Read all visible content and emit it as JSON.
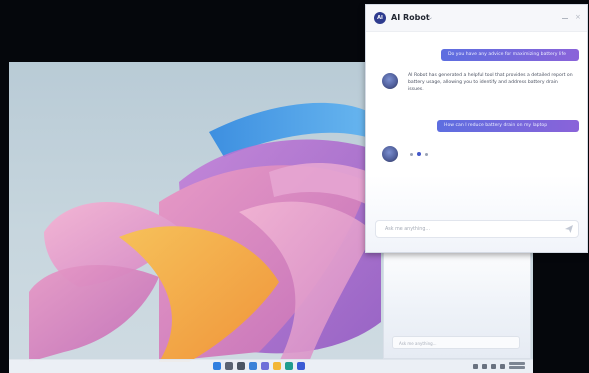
{
  "chat": {
    "title": "AI Robot",
    "logo_text": "AI",
    "messages": [
      {
        "role": "user",
        "text": "Do you have any advice for maximizing battery life"
      },
      {
        "role": "bot",
        "text": "AI Robot has generated a helpful tool that provides a detailed report on battery usage, allowing you to identify and address battery drain issues."
      },
      {
        "role": "user",
        "text": "How can I reduce battery drain on my laptop"
      }
    ],
    "input_placeholder": "Ask me anything...",
    "back_input_placeholder": "Ask me anything..."
  },
  "icons": {
    "app_logo": "ai-robot-logo-icon",
    "minimize": "minimize-icon",
    "close": "close-icon",
    "send": "send-icon",
    "title_chevron": "chevron-down-icon"
  },
  "colors": {
    "accent_start": "#5d6ee0",
    "accent_end": "#8a63d9",
    "logo": "#2e3b8e"
  }
}
